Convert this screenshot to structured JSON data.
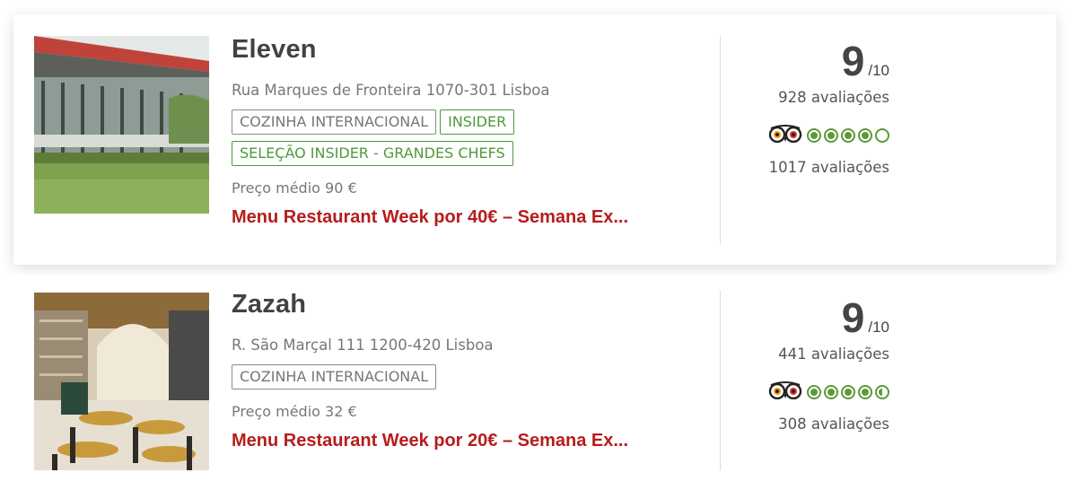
{
  "restaurants": [
    {
      "name": "Eleven",
      "address": "Rua Marques de Fronteira 1070-301 Lisboa",
      "tags": [
        {
          "label": "COZINHA INTERNACIONAL",
          "style": "gray"
        },
        {
          "label": "INSIDER",
          "style": "green"
        },
        {
          "label": "SELEÇÃO INSIDER - GRANDES CHEFS",
          "style": "green"
        }
      ],
      "price": "Preço médio 90 €",
      "promo": "Menu Restaurant Week por 40€ – Semana Ex...",
      "score": "9",
      "scale": "/10",
      "reviews": "928 avaliações",
      "tripadvisor_rating": 4,
      "tripadvisor_reviews": "1017 avaliações"
    },
    {
      "name": "Zazah",
      "address": "R. São Marçal 111 1200-420 Lisboa",
      "tags": [
        {
          "label": "COZINHA INTERNACIONAL",
          "style": "gray"
        }
      ],
      "price": "Preço médio 32 €",
      "promo": "Menu Restaurant Week por 20€ – Semana Ex...",
      "score": "9",
      "scale": "/10",
      "reviews": "441 avaliações",
      "tripadvisor_rating": 4.5,
      "tripadvisor_reviews": "308 avaliações"
    }
  ],
  "icons": {
    "tripadvisor": "tripadvisor-owl-icon",
    "bubble": "rating-bubble-icon"
  },
  "colors": {
    "promo": "#b71c1c",
    "tag_green": "#4e9a3b",
    "bubble_green": "#5b9a3a"
  }
}
